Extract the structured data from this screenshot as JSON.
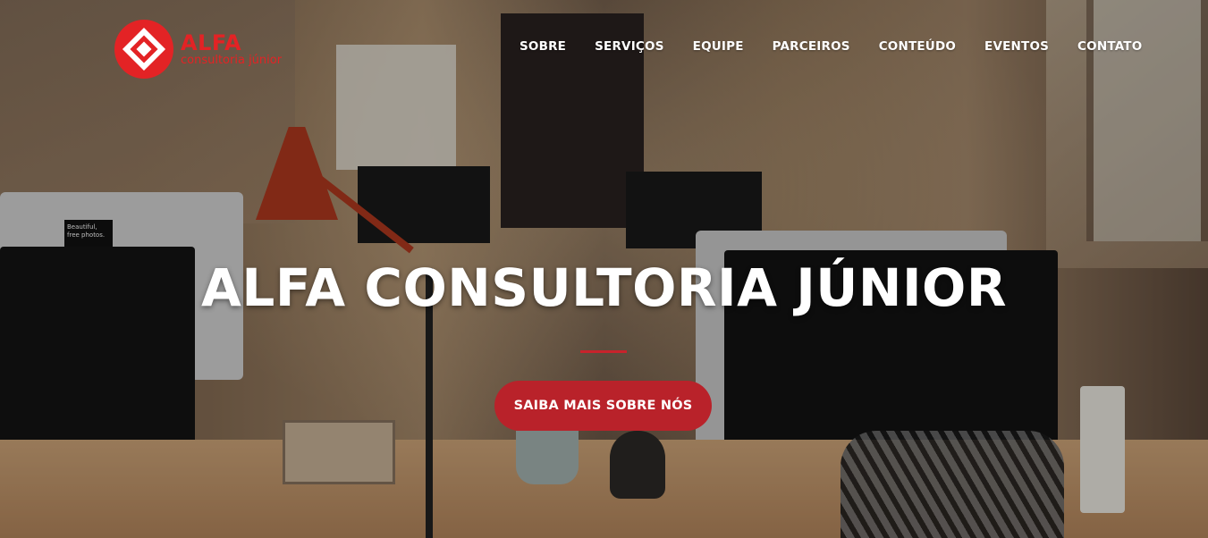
{
  "brand": {
    "name": "ALFA",
    "tagline": "consultoria júnior",
    "color": "#e32325"
  },
  "nav": {
    "items": [
      {
        "label": "SOBRE"
      },
      {
        "label": "SERVIÇOS"
      },
      {
        "label": "EQUIPE"
      },
      {
        "label": "PARCEIROS"
      },
      {
        "label": "CONTEÚDO"
      },
      {
        "label": "EVENTOS"
      },
      {
        "label": "CONTATO"
      }
    ]
  },
  "hero": {
    "title": "ALFA CONSULTORIA JÚNIOR",
    "cta_label": "SAIBA MAIS SOBRE NÓS",
    "accent_color": "#b9222a"
  },
  "background": {
    "image_text": [
      "Beautiful,",
      "free photos."
    ]
  }
}
